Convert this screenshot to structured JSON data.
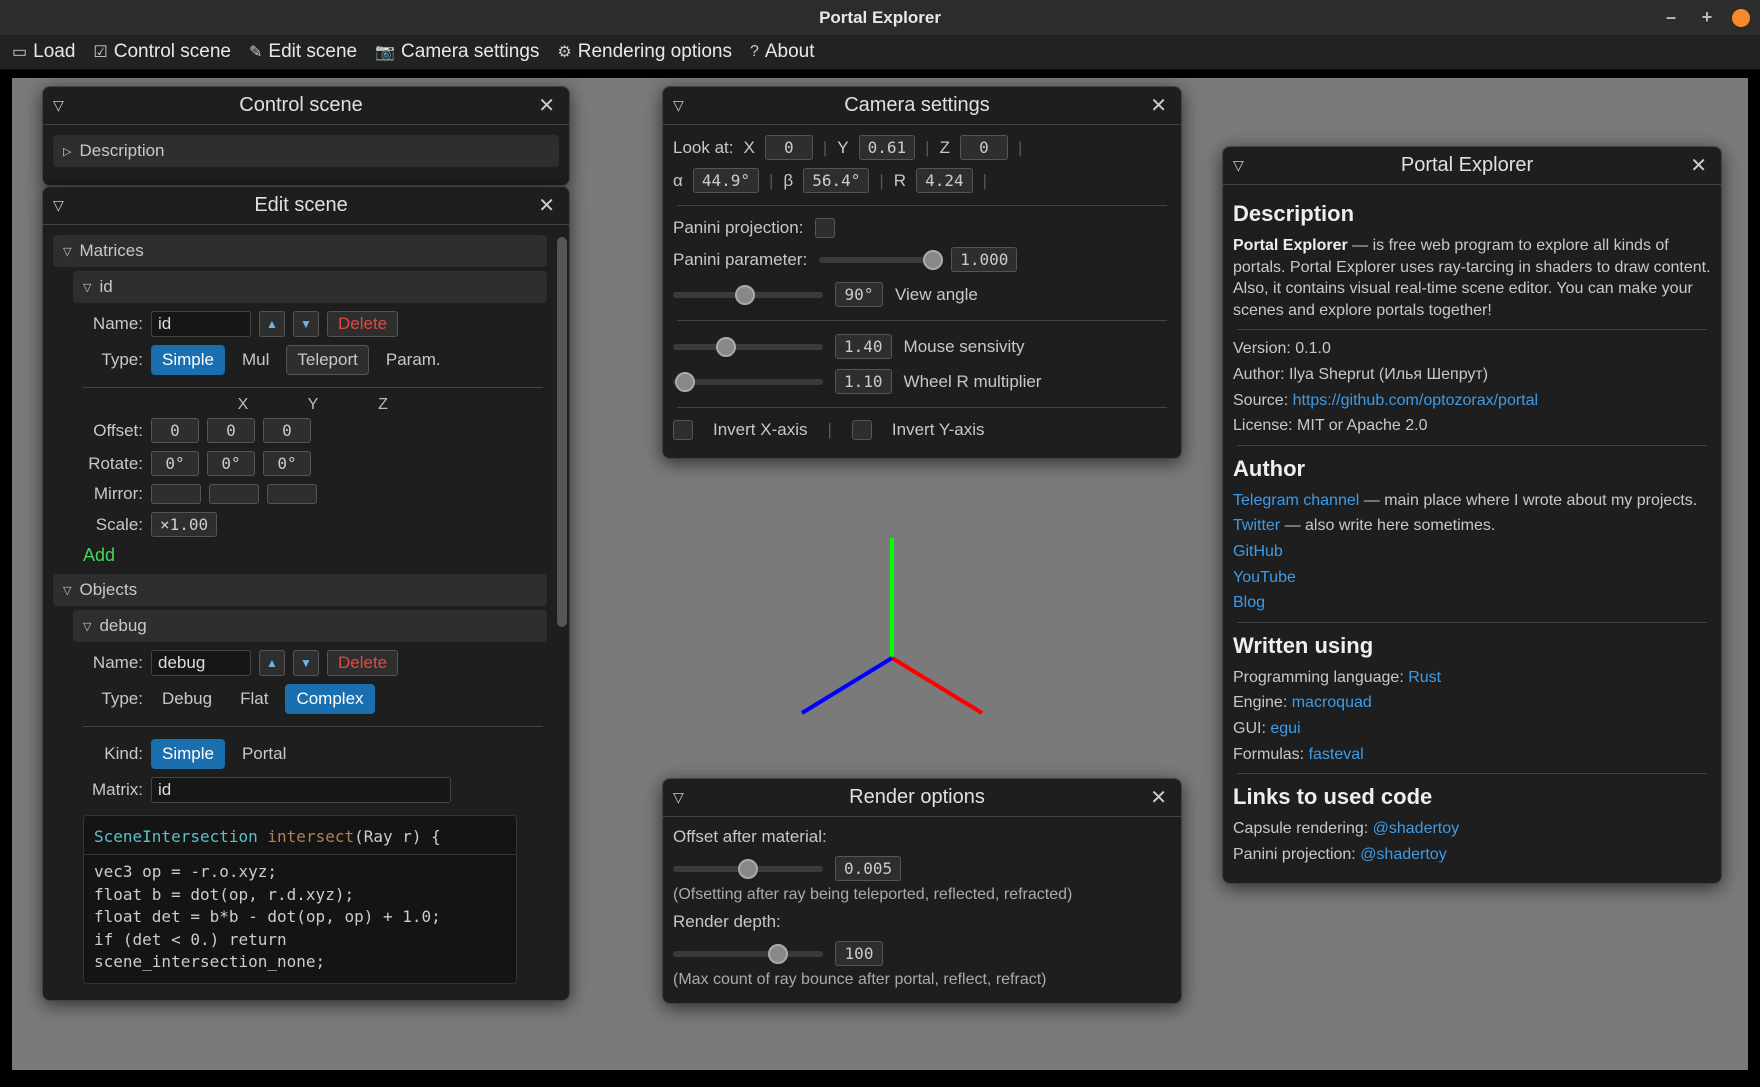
{
  "app": {
    "title": "Portal Explorer"
  },
  "menu": {
    "load": "Load",
    "control_scene": "Control scene",
    "edit_scene": "Edit scene",
    "camera_settings": "Camera settings",
    "rendering_options": "Rendering options",
    "about": "About"
  },
  "control": {
    "title": "Control scene",
    "description": "Description"
  },
  "edit": {
    "title": "Edit scene",
    "matrices": {
      "header": "Matrices",
      "item_header": "id",
      "name_label": "Name:",
      "name_value": "id",
      "type_label": "Type:",
      "types": {
        "simple": "Simple",
        "mul": "Mul",
        "teleport": "Teleport",
        "param": "Param."
      },
      "delete": "Delete",
      "cols": {
        "x": "X",
        "y": "Y",
        "z": "Z"
      },
      "offset": {
        "label": "Offset:",
        "x": "0",
        "y": "0",
        "z": "0"
      },
      "rotate": {
        "label": "Rotate:",
        "x": "0°",
        "y": "0°",
        "z": "0°"
      },
      "mirror": {
        "label": "Mirror:"
      },
      "scale": {
        "label": "Scale:",
        "value": "×1.00"
      },
      "add": "Add"
    },
    "objects": {
      "header": "Objects",
      "item_header": "debug",
      "name_label": "Name:",
      "name_value": "debug",
      "delete": "Delete",
      "type_label": "Type:",
      "types": {
        "debug": "Debug",
        "flat": "Flat",
        "complex": "Complex"
      },
      "kind_label": "Kind:",
      "kinds": {
        "simple": "Simple",
        "portal": "Portal"
      },
      "matrix_label": "Matrix:",
      "matrix_value": "id",
      "code_sig": {
        "ret": "SceneIntersection",
        "fn": "intersect",
        "arg": "(Ray r) {"
      },
      "code_body": "vec3 op = -r.o.xyz;\nfloat b = dot(op, r.d.xyz);\nfloat det = b*b - dot(op, op) + 1.0;\nif (det < 0.) return\nscene_intersection_none;"
    }
  },
  "camera": {
    "title": "Camera settings",
    "lookat_label": "Look at:",
    "x_label": "X",
    "x": "0",
    "y_label": "Y",
    "y": "0.61",
    "z_label": "Z",
    "z": "0",
    "alpha_label": "α",
    "alpha": "44.9°",
    "beta_label": "β",
    "beta": "56.4°",
    "r_label": "R",
    "r": "4.24",
    "panini_proj": "Panini projection:",
    "panini_param": {
      "label": "Panini parameter:",
      "value": "1.000"
    },
    "view_angle": {
      "value": "90°",
      "label": "View angle"
    },
    "mouse": {
      "value": "1.40",
      "label": "Mouse sensivity"
    },
    "wheel": {
      "value": "1.10",
      "label": "Wheel R multiplier"
    },
    "invert_x": "Invert X-axis",
    "invert_y": "Invert Y-axis"
  },
  "render": {
    "title": "Render options",
    "offset": {
      "label": "Offset after material:",
      "value": "0.005",
      "help": "(Ofsetting after ray being teleported, reflected, refracted)"
    },
    "depth": {
      "label": "Render depth:",
      "value": "100",
      "help": "(Max count of ray bounce after portal, reflect, refract)"
    }
  },
  "info": {
    "title": "Portal Explorer",
    "desc_h": "Description",
    "desc_bold": "Portal Explorer",
    "desc": " — is free web program to explore all kinds of portals. Portal Explorer uses ray-tarcing in shaders to draw content. Also, it contains visual real-time scene editor. You can make your scenes and explore portals together!",
    "version_l": "Version: ",
    "version": "0.1.0",
    "author_l": "Author: ",
    "author": "Ilya Sheprut (Илья Шепрут)",
    "source_l": "Source: ",
    "source": "https://github.com/optozorax/portal",
    "license_l": "License: ",
    "license": "MIT or Apache 2.0",
    "author_h": "Author",
    "telegram": "Telegram channel",
    "telegram_tail": " — main place where I wrote about my projects.",
    "twitter": "Twitter",
    "twitter_tail": " — also write here sometimes.",
    "github": "GitHub",
    "youtube": "YouTube",
    "blog": "Blog",
    "written_h": "Written using",
    "lang_l": "Programming language: ",
    "lang": "Rust",
    "engine_l": "Engine: ",
    "engine": "macroquad",
    "gui_l": "GUI: ",
    "gui": "egui",
    "formulas_l": "Formulas: ",
    "formulas": "fasteval",
    "links_h": "Links to used code",
    "capsule_l": "Capsule rendering: ",
    "capsule": "@shadertoy",
    "panini_l": "Panini projection: ",
    "panini": "@shadertoy"
  }
}
